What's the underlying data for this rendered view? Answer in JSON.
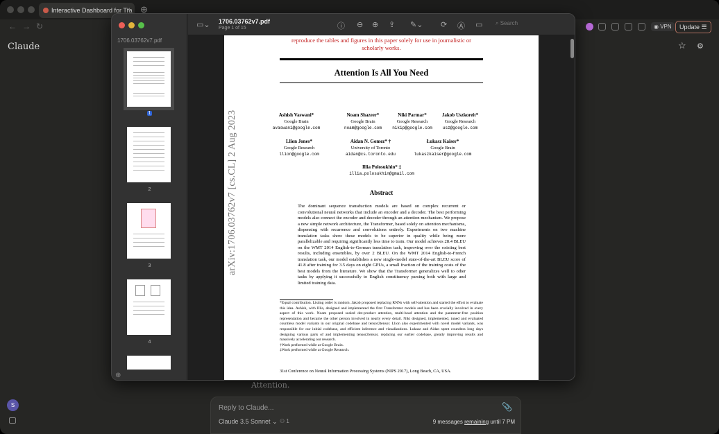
{
  "browser": {
    "tab_title": "Interactive Dashboard for Tra",
    "tab_close": "×",
    "vpn_label": "VPN",
    "update_label": "Update",
    "menu_glyph": "☰"
  },
  "claude": {
    "title": "Claude",
    "reply_placeholder": "Reply to Claude...",
    "model_label": "Claude 3.5 Sonnet",
    "chevron": "⌄",
    "people_count": "1",
    "messages_prefix": "9 messages ",
    "messages_link": "remaining",
    "messages_suffix": " until 7 PM",
    "avatar_initial": "S",
    "bg_tail_text": "Attention."
  },
  "viewer": {
    "sidebar_filename": "1706.03762v7.pdf",
    "doc_title": "1706.03762v7.pdf",
    "page_info": "Page 1 of 15",
    "search_placeholder": "Search",
    "thumbnails": [
      {
        "label": "1"
      },
      {
        "label": "2"
      },
      {
        "label": "3"
      },
      {
        "label": "4"
      }
    ]
  },
  "paper": {
    "red_line_1": "reproduce the tables and figures in this paper solely for use in journalistic or",
    "red_line_2": "scholarly works.",
    "title": "Attention Is All You Need",
    "arxiv_stamp": "arXiv:1706.03762v7  [cs.CL]  2 Aug 2023",
    "authors": [
      {
        "name": "Ashish Vaswani*",
        "org": "Google Brain",
        "email": "avaswani@google.com"
      },
      {
        "name": "Noam Shazeer*",
        "org": "Google Brain",
        "email": "noam@google.com"
      },
      {
        "name": "Niki Parmar*",
        "org": "Google Research",
        "email": "nikip@google.com"
      },
      {
        "name": "Jakob Uszkoreit*",
        "org": "Google Research",
        "email": "usz@google.com"
      },
      {
        "name": "Llion Jones*",
        "org": "Google Research",
        "email": "llion@google.com"
      },
      {
        "name": "Aidan N. Gomez* †",
        "org": "University of Toronto",
        "email": "aidan@cs.toronto.edu"
      },
      {
        "name": "Łukasz Kaiser*",
        "org": "Google Brain",
        "email": "lukaszkaiser@google.com"
      },
      {
        "name": "Illia Polosukhin* ‡",
        "org": "",
        "email": "illia.polosukhin@gmail.com"
      }
    ],
    "abstract_heading": "Abstract",
    "abstract": "The dominant sequence transduction models are based on complex recurrent or convolutional neural networks that include an encoder and a decoder. The best performing models also connect the encoder and decoder through an attention mechanism. We propose a new simple network architecture, the Transformer, based solely on attention mechanisms, dispensing with recurrence and convolutions entirely. Experiments on two machine translation tasks show these models to be superior in quality while being more parallelizable and requiring significantly less time to train. Our model achieves 28.4 BLEU on the WMT 2014 English-to-German translation task, improving over the existing best results, including ensembles, by over 2 BLEU. On the WMT 2014 English-to-French translation task, our model establishes a new single-model state-of-the-art BLEU score of 41.8 after training for 3.5 days on eight GPUs, a small fraction of the training costs of the best models from the literature. We show that the Transformer generalizes well to other tasks by applying it successfully to English constituency parsing both with large and limited training data.",
    "footnote_main": "*Equal contribution. Listing order is random. Jakob proposed replacing RNNs with self-attention and started the effort to evaluate this idea. Ashish, with Illia, designed and implemented the first Transformer models and has been crucially involved in every aspect of this work. Noam proposed scaled dot-product attention, multi-head attention and the parameter-free position representation and became the other person involved in nearly every detail. Niki designed, implemented, tuned and evaluated countless model variants in our original codebase and tensor2tensor. Llion also experimented with novel model variants, was responsible for our initial codebase, and efficient inference and visualizations. Lukasz and Aidan spent countless long days designing various parts of and implementing tensor2tensor, replacing our earlier codebase, greatly improving results and massively accelerating our research.",
    "footnote_dagger": "†Work performed while at Google Brain.",
    "footnote_ddagger": "‡Work performed while at Google Research.",
    "conference": "31st Conference on Neural Information Processing Systems (NIPS 2017), Long Beach, CA, USA."
  }
}
